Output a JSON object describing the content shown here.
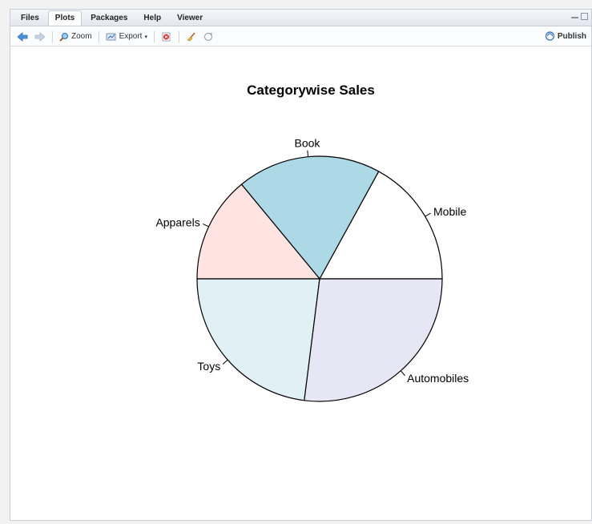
{
  "tabs": [
    {
      "label": "Files",
      "active": false
    },
    {
      "label": "Plots",
      "active": true
    },
    {
      "label": "Packages",
      "active": false
    },
    {
      "label": "Help",
      "active": false
    },
    {
      "label": "Viewer",
      "active": false
    }
  ],
  "toolbar": {
    "zoom_label": "Zoom",
    "export_label": "Export",
    "publish_label": "Publish"
  },
  "icons": {
    "back": "back-arrow-icon",
    "forward": "forward-arrow-icon",
    "zoom": "zoom-icon",
    "export": "export-icon",
    "remove": "remove-plot-icon",
    "clear": "broom-icon",
    "refresh": "refresh-icon",
    "publish": "publish-icon"
  },
  "chart_data": {
    "type": "pie",
    "title": "Categorywise Sales",
    "categories": [
      "Mobile",
      "Book",
      "Apparels",
      "Toys",
      "Automobiles"
    ],
    "values": [
      17,
      19,
      14,
      23,
      27
    ],
    "colors": [
      "#ffffff",
      "#add8e6",
      "#ffe4e1",
      "#e0f0f5",
      "#e6e6f5"
    ],
    "start_angle_deg": 0,
    "direction": "counterclockwise"
  }
}
